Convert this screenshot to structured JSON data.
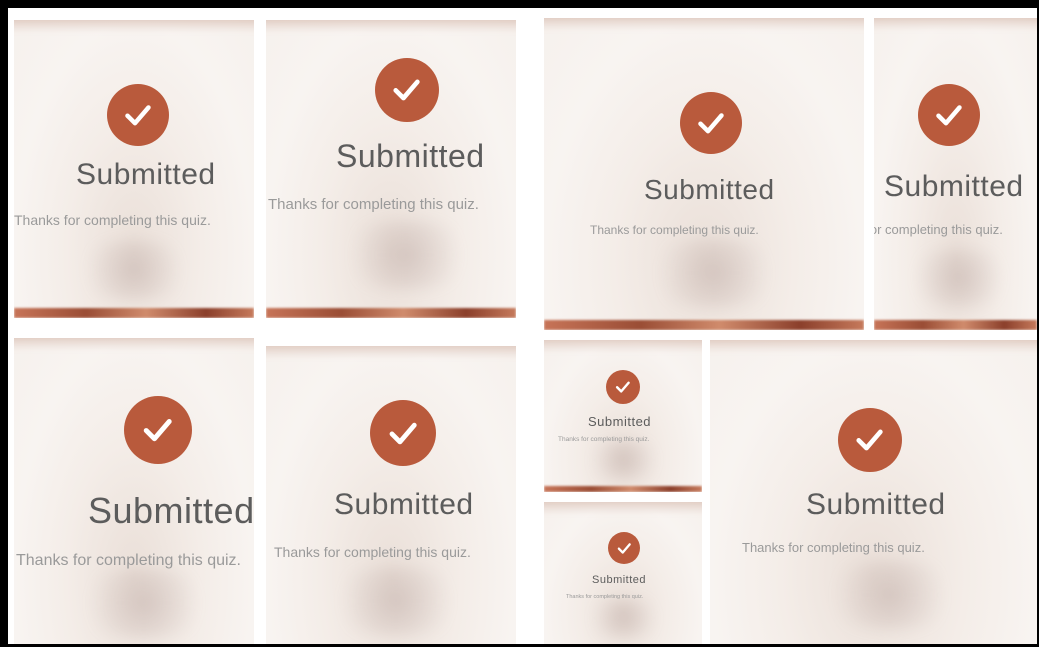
{
  "colors": {
    "check": "#b95a3c",
    "title": "#5c5c5c",
    "subtitle": "#9a9a9a",
    "frame": "#000000"
  },
  "icon": "checkmark-circle-icon",
  "cards": [
    {
      "title": "Submitted",
      "subtitle": "Thanks for completing this quiz."
    },
    {
      "title": "Submitted",
      "subtitle": "Thanks for completing this quiz."
    },
    {
      "title": "Submitted",
      "subtitle": "Thanks for completing this quiz."
    },
    {
      "title": "Submitted",
      "subtitle": "Thanks for completing this quiz."
    },
    {
      "title": "Submitted",
      "subtitle": "Thanks for completing this quiz."
    },
    {
      "title": "Submitted",
      "subtitle": "Thanks for completing this quiz."
    },
    {
      "title": "Submitted",
      "subtitle": "Thanks for completing this quiz."
    },
    {
      "title": "Submitted",
      "subtitle": "Thanks for completing this quiz."
    },
    {
      "title": "Submitted",
      "subtitle": "Thanks for completing this quiz."
    }
  ]
}
